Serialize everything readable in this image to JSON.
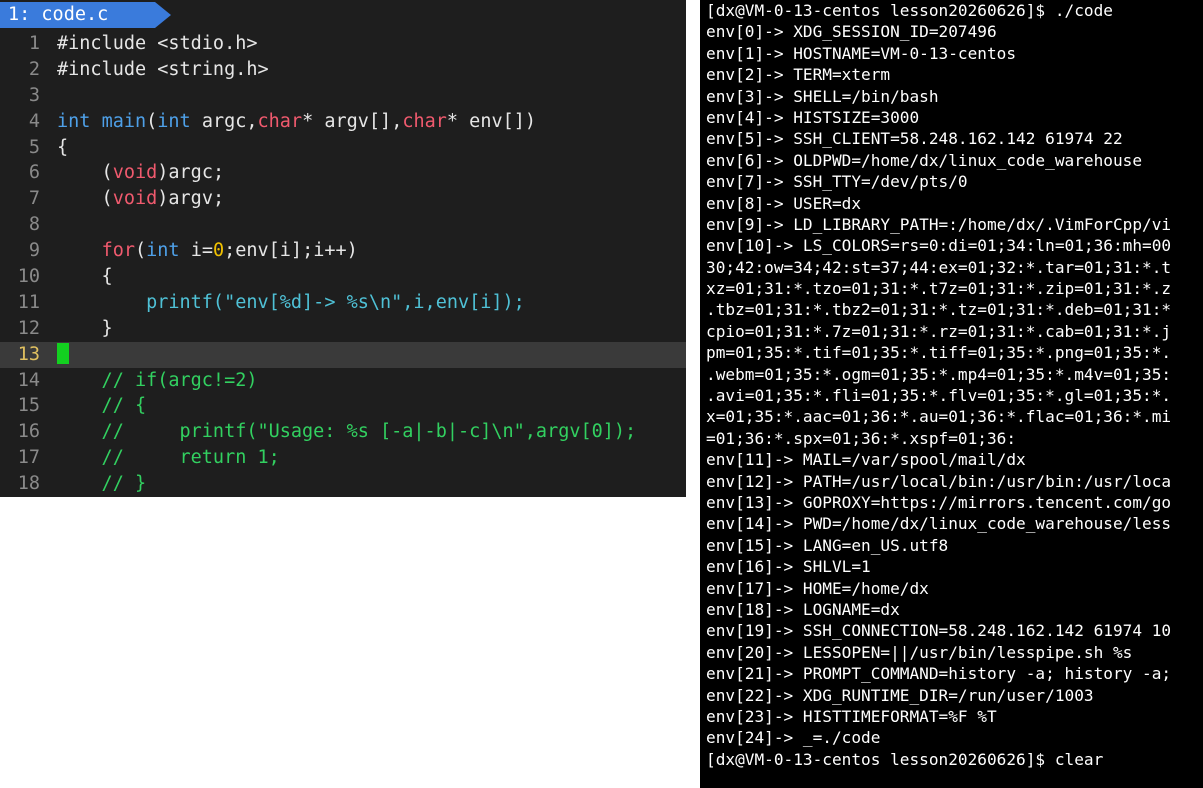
{
  "editor": {
    "tab_label": "1: code.c",
    "lines": [
      {
        "n": "1",
        "tokens": [
          {
            "t": "#include <stdio.h>",
            "c": "c-white"
          }
        ]
      },
      {
        "n": "2",
        "tokens": [
          {
            "t": "#include <string.h>",
            "c": "c-white"
          }
        ]
      },
      {
        "n": "3",
        "tokens": []
      },
      {
        "n": "4",
        "tokens": [
          {
            "t": "int ",
            "c": "c-type"
          },
          {
            "t": "main",
            "c": "c-func"
          },
          {
            "t": "(",
            "c": "c-white"
          },
          {
            "t": "int ",
            "c": "c-type"
          },
          {
            "t": "argc,",
            "c": "c-white"
          },
          {
            "t": "char",
            "c": "c-red"
          },
          {
            "t": "* argv[],",
            "c": "c-white"
          },
          {
            "t": "char",
            "c": "c-red"
          },
          {
            "t": "* env[])",
            "c": "c-white"
          }
        ]
      },
      {
        "n": "5",
        "tokens": [
          {
            "t": "{",
            "c": "c-white"
          }
        ]
      },
      {
        "n": "6",
        "tokens": [
          {
            "t": "    (",
            "c": "c-white"
          },
          {
            "t": "void",
            "c": "c-red"
          },
          {
            "t": ")argc;",
            "c": "c-white"
          }
        ]
      },
      {
        "n": "7",
        "tokens": [
          {
            "t": "    (",
            "c": "c-white"
          },
          {
            "t": "void",
            "c": "c-red"
          },
          {
            "t": ")argv;",
            "c": "c-white"
          }
        ]
      },
      {
        "n": "8",
        "tokens": []
      },
      {
        "n": "9",
        "tokens": [
          {
            "t": "    ",
            "c": "c-white"
          },
          {
            "t": "for",
            "c": "c-red"
          },
          {
            "t": "(",
            "c": "c-white"
          },
          {
            "t": "int ",
            "c": "c-type"
          },
          {
            "t": "i=",
            "c": "c-white"
          },
          {
            "t": "0",
            "c": "c-num"
          },
          {
            "t": ";env[i];i++)",
            "c": "c-white"
          }
        ]
      },
      {
        "n": "10",
        "tokens": [
          {
            "t": "    {",
            "c": "c-white"
          }
        ]
      },
      {
        "n": "11",
        "tokens": [
          {
            "t": "        ",
            "c": "c-white"
          },
          {
            "t": "printf(\"env[%d]-> %s\\n\",i,env[i]);",
            "c": "c-str"
          }
        ]
      },
      {
        "n": "12",
        "tokens": [
          {
            "t": "    }",
            "c": "c-white"
          }
        ]
      },
      {
        "n": "13",
        "tokens": [],
        "cursor": true
      },
      {
        "n": "14",
        "tokens": [
          {
            "t": "    // if(argc!=2)",
            "c": "c-cmt"
          }
        ]
      },
      {
        "n": "15",
        "tokens": [
          {
            "t": "    // {",
            "c": "c-cmt"
          }
        ]
      },
      {
        "n": "16",
        "tokens": [
          {
            "t": "    //     printf(\"Usage: %s [-a|-b|-c]\\n\",argv[0]);",
            "c": "c-cmt"
          }
        ]
      },
      {
        "n": "17",
        "tokens": [
          {
            "t": "    //     return 1;",
            "c": "c-cmt"
          }
        ]
      },
      {
        "n": "18",
        "tokens": [
          {
            "t": "    // }",
            "c": "c-cmt"
          }
        ]
      }
    ]
  },
  "terminal": {
    "lines": [
      "[dx@VM-0-13-centos lesson20260626]$ ./code",
      "env[0]-> XDG_SESSION_ID=207496",
      "env[1]-> HOSTNAME=VM-0-13-centos",
      "env[2]-> TERM=xterm",
      "env[3]-> SHELL=/bin/bash",
      "env[4]-> HISTSIZE=3000",
      "env[5]-> SSH_CLIENT=58.248.162.142 61974 22",
      "env[6]-> OLDPWD=/home/dx/linux_code_warehouse",
      "env[7]-> SSH_TTY=/dev/pts/0",
      "env[8]-> USER=dx",
      "env[9]-> LD_LIBRARY_PATH=:/home/dx/.VimForCpp/vi",
      "env[10]-> LS_COLORS=rs=0:di=01;34:ln=01;36:mh=00",
      "30;42:ow=34;42:st=37;44:ex=01;32:*.tar=01;31:*.t",
      "xz=01;31:*.tzo=01;31:*.t7z=01;31:*.zip=01;31:*.z",
      ".tbz=01;31:*.tbz2=01;31:*.tz=01;31:*.deb=01;31:*",
      "cpio=01;31:*.7z=01;31:*.rz=01;31:*.cab=01;31:*.j",
      "pm=01;35:*.tif=01;35:*.tiff=01;35:*.png=01;35:*.",
      ".webm=01;35:*.ogm=01;35:*.mp4=01;35:*.m4v=01;35:",
      ".avi=01;35:*.fli=01;35:*.flv=01;35:*.gl=01;35:*.",
      "x=01;35:*.aac=01;36:*.au=01;36:*.flac=01;36:*.mi",
      "=01;36:*.spx=01;36:*.xspf=01;36:",
      "env[11]-> MAIL=/var/spool/mail/dx",
      "env[12]-> PATH=/usr/local/bin:/usr/bin:/usr/loca",
      "env[13]-> GOPROXY=https://mirrors.tencent.com/go",
      "env[14]-> PWD=/home/dx/linux_code_warehouse/less",
      "env[15]-> LANG=en_US.utf8",
      "env[16]-> SHLVL=1",
      "env[17]-> HOME=/home/dx",
      "env[18]-> LOGNAME=dx",
      "env[19]-> SSH_CONNECTION=58.248.162.142 61974 10",
      "env[20]-> LESSOPEN=||/usr/bin/lesspipe.sh %s",
      "env[21]-> PROMPT_COMMAND=history -a; history -a;",
      "env[22]-> XDG_RUNTIME_DIR=/run/user/1003",
      "env[23]-> HISTTIMEFORMAT=%F %T",
      "env[24]-> _=./code",
      "[dx@VM-0-13-centos lesson20260626]$ clear"
    ]
  }
}
